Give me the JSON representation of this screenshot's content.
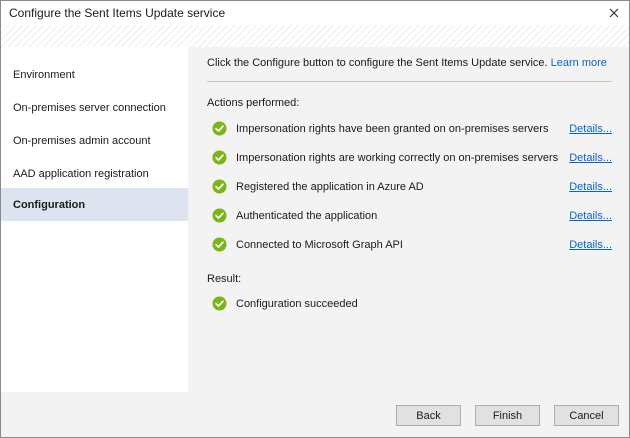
{
  "window": {
    "title": "Configure the Sent Items Update service"
  },
  "sidebar": {
    "items": [
      {
        "label": "Environment"
      },
      {
        "label": "On-premises server connection"
      },
      {
        "label": "On-premises admin account"
      },
      {
        "label": "AAD application registration"
      },
      {
        "label": "Configuration",
        "active": true
      }
    ]
  },
  "content": {
    "intro": "Click the Configure button to configure the Sent Items Update service.",
    "learn_more": "Learn more",
    "actions_label": "Actions performed:",
    "actions": [
      {
        "text": "Impersonation rights have been granted on on-premises servers",
        "link": "Details...",
        "status": "success"
      },
      {
        "text": "Impersonation rights are working correctly on on-premises servers",
        "link": "Details...",
        "status": "success"
      },
      {
        "text": "Registered the application in Azure AD",
        "link": "Details...",
        "status": "success"
      },
      {
        "text": "Authenticated the application",
        "link": "Details...",
        "status": "success"
      },
      {
        "text": "Connected to Microsoft Graph API",
        "link": "Details...",
        "status": "success"
      }
    ],
    "result_label": "Result:",
    "result": {
      "text": "Configuration succeeded",
      "status": "success"
    }
  },
  "footer": {
    "back": "Back",
    "finish": "Finish",
    "cancel": "Cancel"
  },
  "colors": {
    "success": "#7cb518",
    "link": "#0a64c8",
    "active_nav": "#dde4ef",
    "panel": "#f3f3f3"
  },
  "icons": {
    "close": "close-icon",
    "status": "check-circle-icon"
  }
}
